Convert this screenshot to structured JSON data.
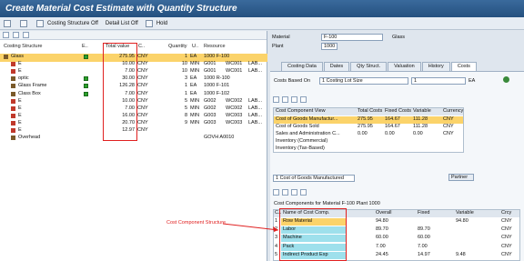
{
  "title": "Create Material Cost Estimate with Quantity Structure",
  "toolbar": {
    "costing_structure_off": "Costing Structure Off",
    "detail_list_off": "Detail List Off",
    "hold": "Hold"
  },
  "left_headers": {
    "costing_structure": "Costing Structure",
    "e": "E..",
    "total_value": "Total value",
    "c": "C..",
    "quantity": "Quantity",
    "u": "U..",
    "resource": "Resource"
  },
  "tree": [
    {
      "name": "Glass",
      "total": "275.95",
      "curr": "CNY",
      "qty": "1",
      "unit": "EA",
      "resource": "1000 F-100",
      "extra": "",
      "green": true
    },
    {
      "name": "E",
      "total": "10.00",
      "curr": "CNY",
      "qty": "10",
      "unit": "MIN",
      "resource": "G001",
      "wc": "WC001",
      "lab": "LAB...",
      "green": false
    },
    {
      "name": "E",
      "total": "7.00",
      "curr": "CNY",
      "qty": "10",
      "unit": "MIN",
      "resource": "G001",
      "wc": "WC001",
      "lab": "LAB...",
      "green": false
    },
    {
      "name": "optic",
      "total": "30.00",
      "curr": "CNY",
      "qty": "3",
      "unit": "EA",
      "resource": "1000 R-100",
      "wc": "",
      "lab": "",
      "green": true
    },
    {
      "name": "Glass Frame",
      "total": "126.28",
      "curr": "CNY",
      "qty": "1",
      "unit": "EA",
      "resource": "1000 F-101",
      "wc": "",
      "lab": "",
      "green": true
    },
    {
      "name": "Class Box",
      "total": "7.00",
      "curr": "CNY",
      "qty": "1",
      "unit": "EA",
      "resource": "1000 F-102",
      "wc": "",
      "lab": "",
      "green": true
    },
    {
      "name": "E",
      "total": "10.00",
      "curr": "CNY",
      "qty": "5",
      "unit": "MIN",
      "resource": "G002",
      "wc": "WC002",
      "lab": "LAB...",
      "green": false
    },
    {
      "name": "E",
      "total": "7.00",
      "curr": "CNY",
      "qty": "5",
      "unit": "MIN",
      "resource": "G002",
      "wc": "WC002",
      "lab": "LAB...",
      "green": false
    },
    {
      "name": "E",
      "total": "16.00",
      "curr": "CNY",
      "qty": "8",
      "unit": "MIN",
      "resource": "G003",
      "wc": "WC003",
      "lab": "LAB...",
      "green": false
    },
    {
      "name": "E",
      "total": "20.70",
      "curr": "CNY",
      "qty": "9",
      "unit": "MIN",
      "resource": "G003",
      "wc": "WC003",
      "lab": "LAB...",
      "green": false
    },
    {
      "name": "E",
      "total": "12.97",
      "curr": "CNY",
      "qty": "",
      "unit": "",
      "resource": "",
      "wc": "",
      "lab": "",
      "green": false
    },
    {
      "name": "Overhead",
      "total": "",
      "curr": "",
      "qty": "",
      "unit": "",
      "resource": "GOVH A0010",
      "wc": "",
      "lab": "",
      "green": false
    }
  ],
  "material": {
    "label": "Material",
    "value": "F-100",
    "desc": "Glass"
  },
  "plant": {
    "label": "Plant",
    "value": "1000"
  },
  "tabs": [
    "Costing Data",
    "Dates",
    "Qty Struct.",
    "Valuation",
    "History",
    "Costs"
  ],
  "costs_based_on": {
    "label": "Costs Based On",
    "value": "1 Costing Lot Size",
    "qty": "1",
    "unit": "EA"
  },
  "cost_table": {
    "headers": [
      "Cost Component View",
      "Total Costs",
      "Fixed Costs",
      "Variable",
      "Currency"
    ],
    "rows": [
      [
        "Cost of Goods Manufactur...",
        "275.95",
        "164.67",
        "111.28",
        "CNY"
      ],
      [
        "Cost of Goods Sold",
        "275.95",
        "164.67",
        "111.28",
        "CNY"
      ],
      [
        "Sales and Administration C...",
        "0.00",
        "0.00",
        "0.00",
        "CNY"
      ],
      [
        "Inventory (Commercial)",
        "",
        "",
        "",
        ""
      ],
      [
        "Inventory (Tax-Based)",
        "",
        "",
        "",
        ""
      ]
    ]
  },
  "view_select": {
    "value": "1 Cost of Goods Manufactured",
    "partner": "Partner"
  },
  "comp_title": "Cost Components for Material F-100 Plant 1000",
  "comp_table": {
    "headers": [
      "C..",
      "Name of Cost Comp.",
      "Overall",
      "Fixed",
      "Variable",
      "Crcy"
    ],
    "rows": [
      [
        "1",
        "Row Material",
        "94.80",
        "",
        "94.80",
        "CNY"
      ],
      [
        "2",
        "Labor",
        "89.70",
        "89.70",
        "",
        "CNY"
      ],
      [
        "3",
        "Machine",
        "60.00",
        "60.00",
        "",
        "CNY"
      ],
      [
        "4",
        "Pack",
        "7.00",
        "7.00",
        "",
        "CNY"
      ],
      [
        "5",
        "Indirect Product Exp",
        "24.45",
        "14.97",
        "9.48",
        "CNY"
      ]
    ]
  },
  "annotation": "Cost Component Structure"
}
